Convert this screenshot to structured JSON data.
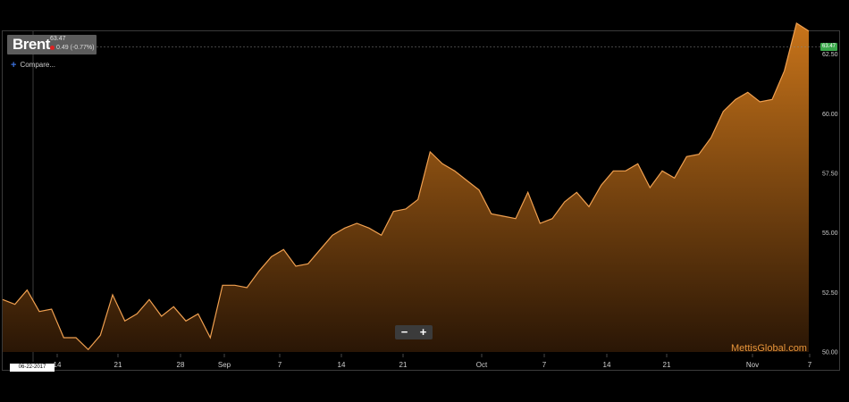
{
  "header": {
    "ticker": "Brent",
    "price": "63.47",
    "change": "0.49 (-0.77%)",
    "compare_label": "Compare..."
  },
  "controls": {
    "zoom_out": "−",
    "zoom_in": "+"
  },
  "crosshair_date": "06-22-2017",
  "last_price_marker": "63.47",
  "watermark": "MettisGlobal.com",
  "colors": {
    "background": "#000000",
    "area_top": "#c8741a",
    "area_bottom": "#2a1605",
    "line": "#f0a050",
    "price_marker": "#3aa84a",
    "watermark": "#e8953a"
  },
  "chart_data": {
    "type": "area",
    "title": "Brent",
    "x_tick_labels": [
      "14",
      "21",
      "28",
      "Sep",
      "7",
      "14",
      "21",
      "Oct",
      "7",
      "14",
      "21",
      "Nov",
      "7"
    ],
    "y_tick_labels": [
      "50.00",
      "52.50",
      "55.00",
      "57.50",
      "60.00",
      "62.50"
    ],
    "ylim": [
      50,
      63.5
    ],
    "grid": false,
    "series": [
      {
        "values": [
          52.2,
          52.0,
          52.6,
          51.7,
          51.8,
          50.6,
          50.6,
          50.1,
          50.7,
          52.4,
          51.3,
          51.6,
          52.2,
          51.5,
          51.9,
          51.3,
          51.6,
          50.6,
          52.8,
          52.8,
          52.7,
          53.4,
          54.0,
          54.3,
          53.6,
          53.7,
          54.3,
          54.9,
          55.2,
          55.4,
          55.2,
          54.9,
          55.9,
          56.0,
          56.4,
          58.4,
          57.9,
          57.6,
          57.2,
          56.8,
          55.8,
          55.7,
          55.6,
          56.7,
          55.4,
          55.6,
          56.3,
          56.7,
          56.1,
          57.0,
          57.6,
          57.6,
          57.9,
          56.9,
          57.6,
          57.3,
          58.2,
          58.3,
          59.0,
          60.1,
          60.6,
          60.9,
          60.5,
          60.6,
          61.8,
          63.8,
          63.47
        ]
      }
    ]
  }
}
